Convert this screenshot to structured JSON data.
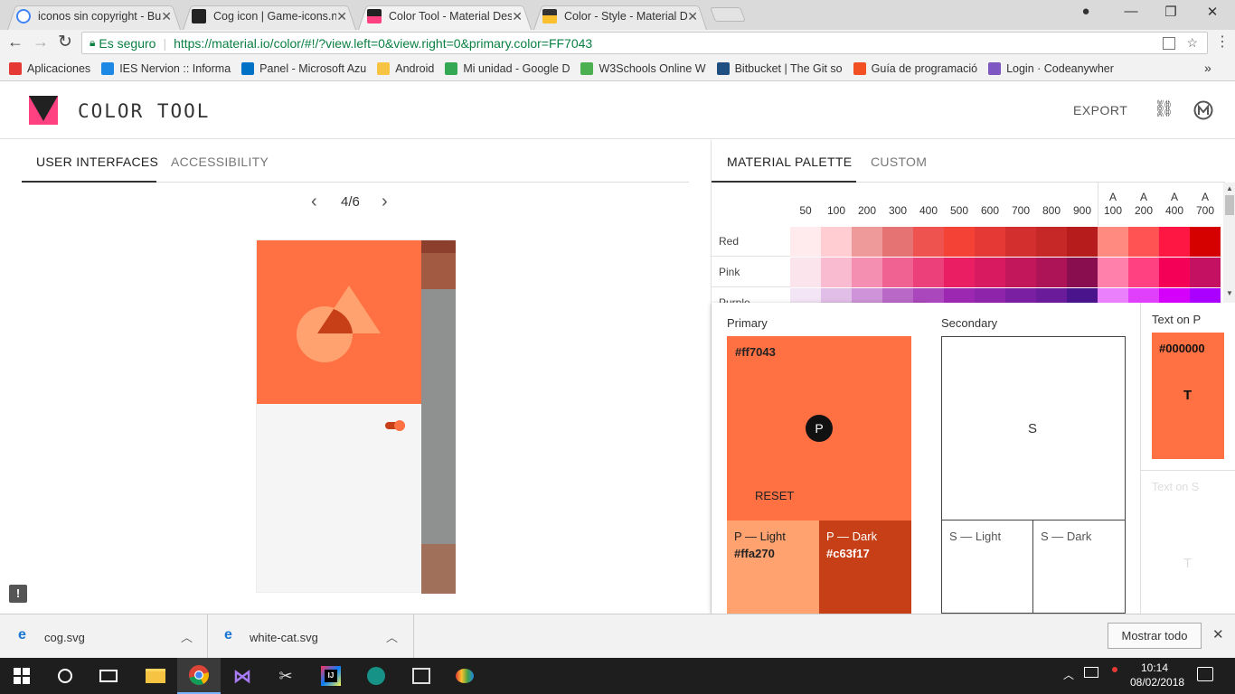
{
  "browser": {
    "tabs": [
      {
        "title": "iconos sin copyright - Bu",
        "favicon_color": "#4285f4",
        "active": false
      },
      {
        "title": "Cog icon | Game-icons.ne",
        "favicon_color": "#222222",
        "active": false
      },
      {
        "title": "Color Tool - Material Des",
        "favicon_color": "#ff4081",
        "active": true
      },
      {
        "title": "Color - Style - Material D",
        "favicon_color": "#fbc02d",
        "active": false
      }
    ],
    "secure_label": "Es seguro",
    "url": "https://material.io/color/#!/?view.left=0&view.right=0&primary.color=FF7043",
    "bookmarks": [
      {
        "label": "Aplicaciones",
        "icon": "apps-grid-icon",
        "color": "#e53935"
      },
      {
        "label": "IES Nervion :: Informa",
        "icon": "ies-icon",
        "color": "#1e88e5"
      },
      {
        "label": "Panel - Microsoft Azu",
        "icon": "azure-icon",
        "color": "#0072c6"
      },
      {
        "label": "Android",
        "icon": "folder-icon",
        "color": "#f6c343"
      },
      {
        "label": "Mi unidad - Google D",
        "icon": "drive-icon",
        "color": "#34a853"
      },
      {
        "label": "W3Schools Online W",
        "icon": "w3schools-icon",
        "color": "#4caf50"
      },
      {
        "label": "Bitbucket | The Git so",
        "icon": "bitbucket-icon",
        "color": "#205081"
      },
      {
        "label": "Guía de programació",
        "icon": "windows-icon",
        "color": "#f25022"
      },
      {
        "label": "Login · Codeanywher",
        "icon": "codeanywhere-icon",
        "color": "#7e57c2"
      }
    ]
  },
  "app": {
    "title": "COLOR TOOL",
    "export_label": "EXPORT",
    "left_tabs": [
      "USER INTERFACES",
      "ACCESSIBILITY"
    ],
    "pager": "4/6",
    "right_tabs": [
      "MATERIAL PALETTE",
      "CUSTOM"
    ]
  },
  "palette": {
    "columns": [
      "50",
      "100",
      "200",
      "300",
      "400",
      "500",
      "600",
      "700",
      "800",
      "900"
    ],
    "accent_columns": [
      {
        "a": "A",
        "n": "100"
      },
      {
        "a": "A",
        "n": "200"
      },
      {
        "a": "A",
        "n": "400"
      },
      {
        "a": "A",
        "n": "700"
      }
    ],
    "rows": [
      {
        "name": "Red",
        "colors": [
          "#ffebee",
          "#ffcdd2",
          "#ef9a9a",
          "#e57373",
          "#ef5350",
          "#f44336",
          "#e53935",
          "#d32f2f",
          "#c62828",
          "#b71c1c",
          "#ff8a80",
          "#ff5252",
          "#ff1744",
          "#d50000"
        ]
      },
      {
        "name": "Pink",
        "colors": [
          "#fce4ec",
          "#f8bbd0",
          "#f48fb1",
          "#f06292",
          "#ec407a",
          "#e91e63",
          "#d81b60",
          "#c2185b",
          "#ad1457",
          "#880e4f",
          "#ff80ab",
          "#ff4081",
          "#f50057",
          "#c51162"
        ]
      },
      {
        "name": "Purple",
        "colors": [
          "#f3e5f5",
          "#e1bee7",
          "#ce93d8",
          "#ba68c8",
          "#ab47bc",
          "#9c27b0",
          "#8e24aa",
          "#7b1fa2",
          "#6a1b9a",
          "#4a148c",
          "#ea80fc",
          "#e040fb",
          "#d500f9",
          "#aa00ff"
        ]
      }
    ]
  },
  "primary": {
    "label": "Primary",
    "hex": "#ff7043",
    "badge": "P",
    "reset_label": "RESET",
    "light_label": "P — Light",
    "light_hex": "#ffa270",
    "dark_label": "P — Dark",
    "dark_hex": "#c63f17"
  },
  "secondary": {
    "label": "Secondary",
    "badge": "S",
    "light_label": "S — Light",
    "dark_label": "S — Dark"
  },
  "text_on_p": {
    "label": "Text on P",
    "hex": "#000000",
    "glyph": "T"
  },
  "text_on_s": {
    "label": "Text on S",
    "glyph": "T"
  },
  "downloads": {
    "items": [
      "cog.svg",
      "white-cat.svg"
    ],
    "show_all_label": "Mostrar todo"
  },
  "taskbar": {
    "time": "10:14",
    "date": "08/02/2018"
  }
}
